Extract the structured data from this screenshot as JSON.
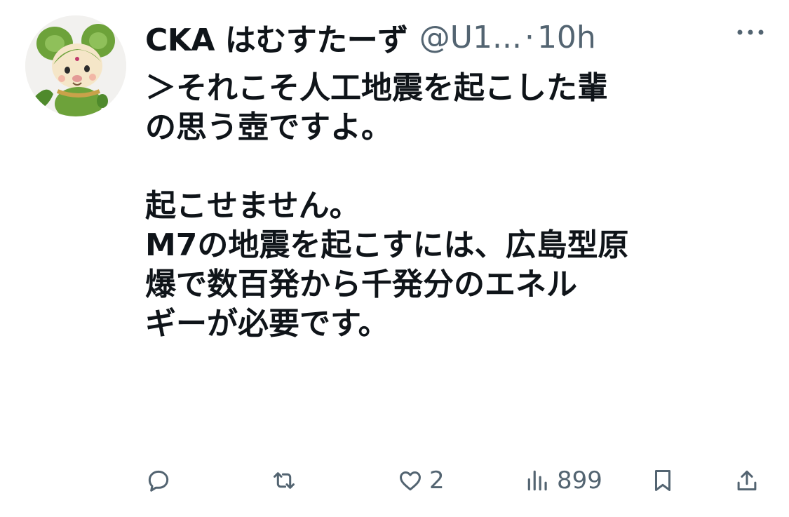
{
  "author": {
    "name": "CKA はむすたーず",
    "handle": "@U1...",
    "separator": "·",
    "time": "10h"
  },
  "tweet": {
    "lines": [
      "＞それこそ人工地震を起こした輩",
      "の思う壺ですよ。",
      "",
      "起こせません。",
      "M7の地震を起こすには、広島型原",
      "爆で数百発から千発分のエネル",
      "ギーが必要です。"
    ]
  },
  "actions": {
    "reply_count": "",
    "retweet_count": "",
    "like_count": "2",
    "views_count": "899"
  },
  "icons": {
    "more": "more-icon",
    "reply": "reply-icon",
    "retweet": "retweet-icon",
    "like": "heart-icon",
    "views": "views-icon",
    "bookmark": "bookmark-icon",
    "share": "share-icon"
  },
  "colors": {
    "text": "#0f1419",
    "secondary": "#536471",
    "avatar_green": "#6da23a"
  }
}
